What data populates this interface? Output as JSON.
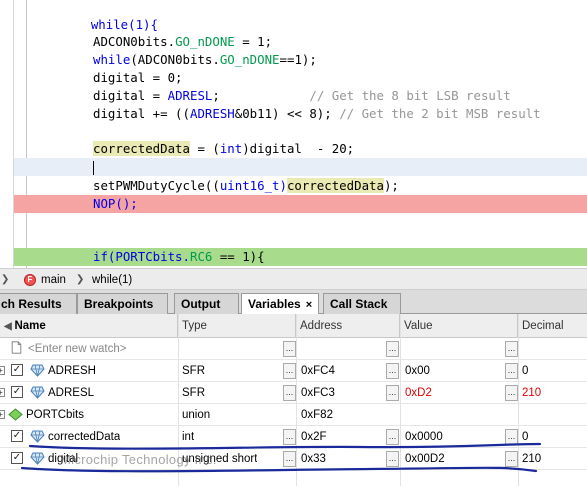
{
  "editor": {
    "lines": {
      "while": "while(1){",
      "adcon_prefix": "ADCON0bits.",
      "go_ndone": "GO_nDONE",
      "adcon_suffix": " = 1;",
      "while_kw": "while",
      "while2_mid": "(ADCON0bits.",
      "go_ndone2": "GO_nDONE",
      "while2_end": "==1);",
      "digital_zero": "digital = 0;",
      "digital_eq": "digital = ",
      "adresl": "ADRESL",
      "digital_eq_end": ";",
      "comment_lsb": "// Get the 8 bit LSB result",
      "digital_add_pre": "digital += ((",
      "adresh": "ADRESH",
      "digital_add_post": "&0b11) << 8); ",
      "comment_msb": "// Get the 2 bit MSB result",
      "corrected": "correctedData",
      "corrected_rest_a": " = (",
      "int_kw": "int",
      "corrected_rest_b": ")digital  - 20;",
      "pwm_pre": "setPWMDutyCycle((",
      "uint_kw": "uint16_t)",
      "pwm_arg": "correctedData",
      "pwm_post": ");",
      "nop": "NOP();",
      "if_pre": "if(PORTCbits.",
      "rc6": "RC6",
      "if_post": " == 1){"
    }
  },
  "breadcrumb": {
    "func_icon_glyph": "F",
    "function": "main",
    "block": "while(1)"
  },
  "tabs": [
    {
      "label": "ch Results"
    },
    {
      "label": "Breakpoints"
    },
    {
      "label": "Output"
    },
    {
      "label": "Variables",
      "close": "×"
    },
    {
      "label": "Call Stack"
    }
  ],
  "variables": {
    "headers": {
      "name": "Name",
      "type": "Type",
      "address": "Address",
      "value": "Value",
      "decimal": "Decimal"
    },
    "new_watch_placeholder": "<Enter new watch>",
    "ellipsis": "...",
    "rows": [
      {
        "name": "ADRESH",
        "type": "SFR",
        "address": "0xFC4",
        "value": "0x00",
        "decimal": "0",
        "icon": "sfr-diamond-icon"
      },
      {
        "name": "ADRESL",
        "type": "SFR",
        "address": "0xFC3",
        "value": "0xD2",
        "decimal": "210",
        "icon": "sfr-diamond-icon"
      },
      {
        "name": "PORTCbits",
        "type": "union",
        "address": "0xF82",
        "value": "",
        "decimal": "",
        "icon": "union-diamond-icon"
      },
      {
        "name": "correctedData",
        "type": "int",
        "address": "0x2F",
        "value": "0x0000",
        "decimal": "0",
        "icon": "variable-diamond-icon"
      },
      {
        "name": "digital",
        "type": "unsigned short",
        "address": "0x33",
        "value": "0x00D2",
        "decimal": "210",
        "icon": "variable-diamond-icon"
      }
    ]
  },
  "colors": {
    "changed_value": "#e00000",
    "annotation_ink": "#1a2a9a",
    "current_line": "#e8eef8",
    "breakpoint_line": "#f6a3a3",
    "pc_line": "#a8dc8c"
  },
  "watermark": "Microchip Technology Inc."
}
